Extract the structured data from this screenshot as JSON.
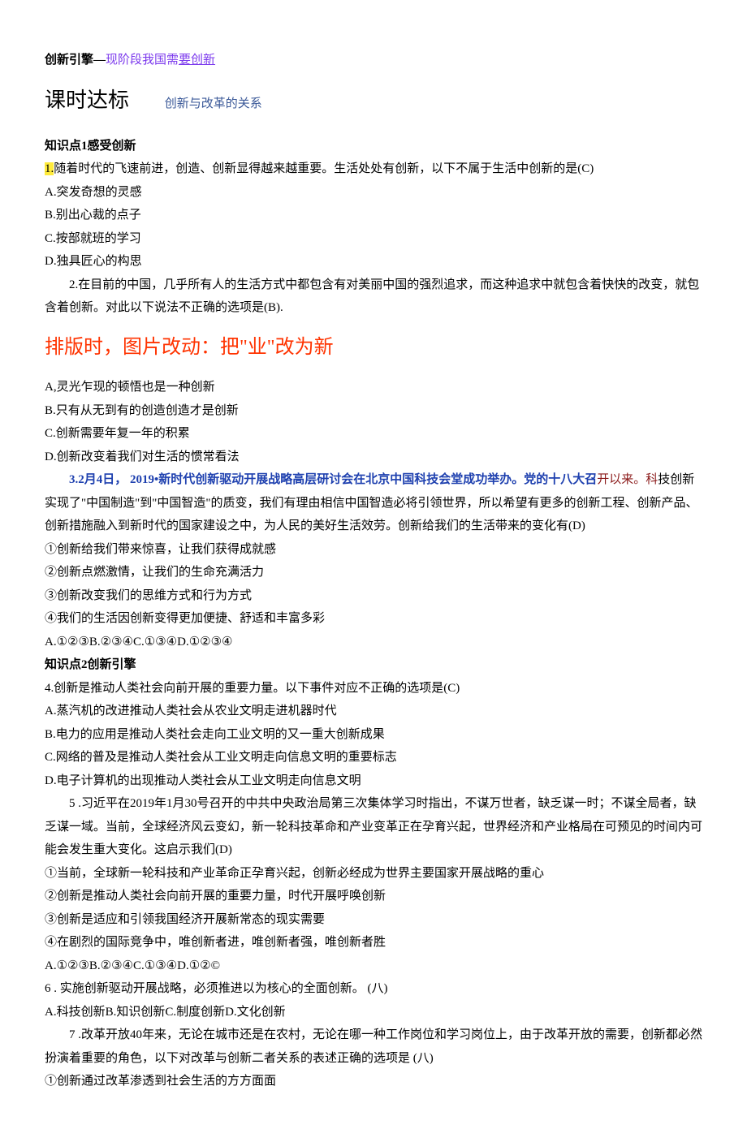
{
  "header": {
    "engine_label": "创新引擎—",
    "engine_suffix_plain": "现阶段我国需",
    "engine_suffix_underline": "要创新"
  },
  "title": {
    "main": "课时达标",
    "sub": "创新与改革的关系"
  },
  "kp1": {
    "heading": "知识点1感受创新",
    "q1_num": "1.",
    "q1_text": "随着时代的飞速前进，创造、创新显得越来越重要。生活处处有创新，以下不属于生活中创新的是(C)",
    "q1_a": "A.突发奇想的灵感",
    "q1_b": "B.别出心裁的点子",
    "q1_c": "C.按部就班的学习",
    "q1_d": "D.独具匠心的构思",
    "q2": "2.在目前的中国，几乎所有人的生活方式中都包含有对美丽中国的强烈追求，而这种追求中就包含着快快的改变，就包含着创新。对此以下说法不正确的选项是(B).",
    "edit_note": "排版时，图片改动：把\"业\"改为新",
    "q2_a": "A,灵光乍现的顿悟也是一种创新",
    "q2_b": "B.只有从无到有的创造创造才是创新",
    "q2_c": "C.创新需要年复一年的积累",
    "q2_d": "D.创新改变着我们对生活的惯常看法",
    "q3_blue": "3.2月4日， 2019•新时代创新驱动开展战略高层研讨会在北京中国科技会堂成功举办。党的十八大召",
    "q3_blue_tail": "开以来。科",
    "q3_rest": "技创新实现了\"中国制造\"到\"中国智造\"的质变，我们有理由相信中国智造必将引领世界，所以希望有更多的创新工程、创新产品、创新措施融入到新时代的国家建设之中，为人民的美好生活效劳。创新给我们的生活带来的变化有(D)",
    "q3_1": "①创新给我们带来惊喜，让我们获得成就感",
    "q3_2": "②创新点燃激情，让我们的生命充满活力",
    "q3_3": "③创新改变我们的思维方式和行为方式",
    "q3_4": "④我们的生活因创新变得更加便捷、舒适和丰富多彩",
    "q3_opts": "A.①②③B.②③④C.①③④D.①②③④"
  },
  "kp2": {
    "heading": "知识点2创新引擎",
    "q4": "4.创新是推动人类社会向前开展的重要力量。以下事件对应不正确的选项是(C)",
    "q4_a": "A.蒸汽机的改进推动人类社会从农业文明走进机器时代",
    "q4_b": "B.电力的应用是推动人类社会走向工业文明的又一重大创新成果",
    "q4_c": "C.网络的普及是推动人类社会从工业文明走向信息文明的重要标志",
    "q4_d": "D.电子计算机的出现推动人类社会从工业文明走向信息文明",
    "q5": "5 .习近平在2019年1月30号召开的中共中央政治局第三次集体学习时指出，不谋万世者，缺乏谋一时；不谋全局者，缺乏谋一域。当前，全球经济风云变幻，新一轮科技革命和产业变革正在孕育兴起，世界经济和产业格局在可预见的时间内可能会发生重大变化。这启示我们(D)",
    "q5_1": "①当前，全球新一轮科技和产业革命正孕育兴起，创新必经成为世界主要国家开展战略的重心",
    "q5_2": "②创新是推动人类社会向前开展的重要力量，时代开展呼唤创新",
    "q5_3": "③创新是适应和引领我国经济开展新常态的现实需要",
    "q5_4": "④在剧烈的国际竞争中，唯创新者进，唯创新者强，唯创新者胜",
    "q5_opts": "A.①②③B.②③④C.①③④D.①②©",
    "q6": "6 . 实施创新驱动开展战略，必须推进以为核心的全面创新。 (八)",
    "q6_opts": "A.科技创新B.知识创新C.制度创新D.文化创新",
    "q7": "7 .改革开放40年来，无论在城市还是在农村，无论在哪一种工作岗位和学习岗位上，由于改革开放的需要，创新都必然扮演着重要的角色，以下对改革与创新二者关系的表述正确的选项是 (八)",
    "q7_1": "①创新通过改革渗透到社会生活的方方面面"
  }
}
